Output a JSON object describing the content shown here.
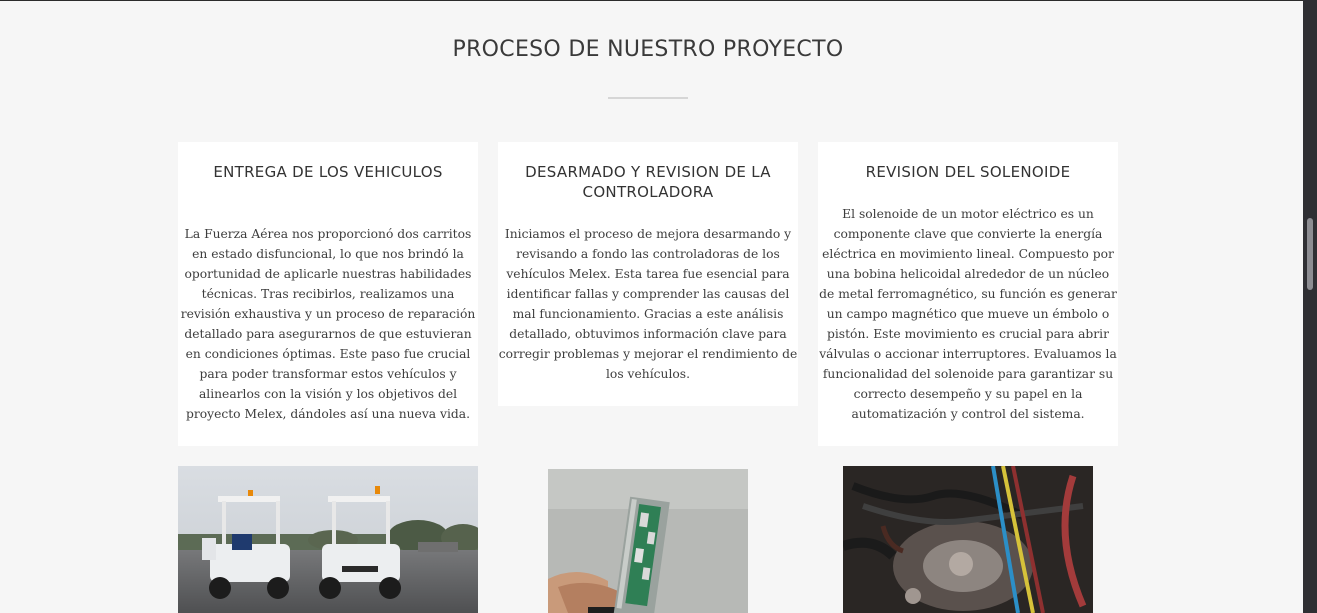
{
  "section": {
    "title": "PROCESO DE NUESTRO PROYECTO"
  },
  "cards": [
    {
      "heading": "ENTREGA DE LOS VEHICULOS",
      "text": "La Fuerza Aérea nos proporcionó dos carritos en estado disfuncional, lo que nos brindó la oportunidad de aplicarle nuestras habilidades técnicas. Tras recibirlos, realizamos una revisión exhaustiva y un proceso de reparación detallado para asegurarnos de que estuvieran en condiciones óptimas. Este paso fue crucial para poder transformar estos vehículos y alinearlos con la visión y los objetivos del proyecto Melex, dándoles así una nueva vida."
    },
    {
      "heading": "DESARMADO Y REVISION DE LA CONTROLADORA",
      "text": "Iniciamos el proceso de mejora desarmando y revisando a fondo las controladoras de los vehículos Melex. Esta tarea fue esencial para identificar fallas y comprender las causas del mal funcionamiento. Gracias a este análisis detallado, obtuvimos información clave para corregir problemas y mejorar el rendimiento de los vehículos."
    },
    {
      "heading": "REVISION DEL SOLENOIDE",
      "text": "El solenoide de un motor eléctrico es un componente clave que convierte la energía eléctrica en movimiento lineal. Compuesto por una bobina helicoidal alrededor de un núcleo de metal ferromagnético, su función es generar un campo magnético que mueve un émbolo o pistón. Este movimiento es crucial para abrir válvulas o accionar interruptores. Evaluamos la funcionalidad del solenoide para garantizar su correcto desempeño y su papel en la automatización y control del sistema."
    }
  ],
  "colors": {
    "background": "#f6f6f6",
    "card": "#ffffff",
    "heading": "#333333",
    "scrollbar": "#2f2f33"
  }
}
